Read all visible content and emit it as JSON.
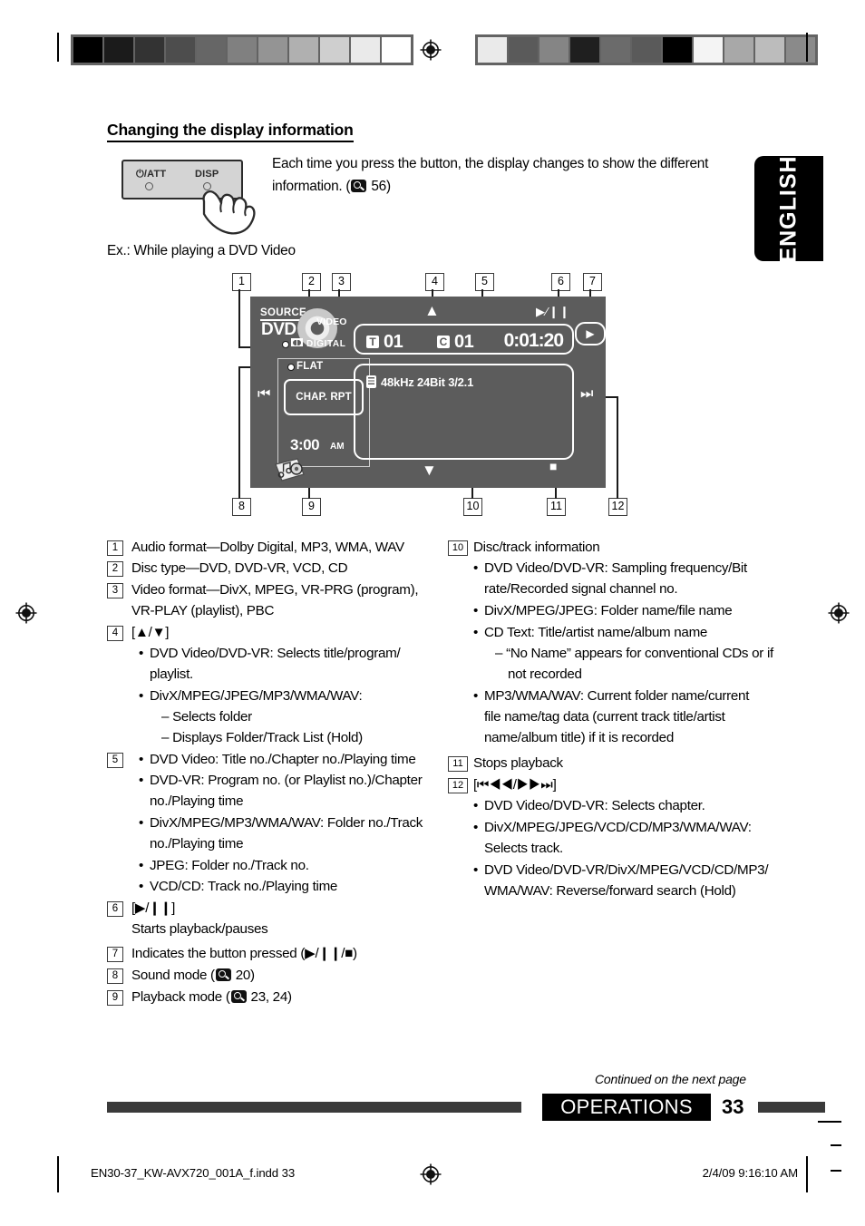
{
  "page": {
    "language_tab": "ENGLISH",
    "section_heading": "Changing the display information",
    "intro_line1": "Each time you press the button, the display changes to show the different",
    "intro_line2_pre": "information. (",
    "intro_page_ref": "56",
    "intro_line2_post": ")",
    "example_label": "Ex.:  While playing a DVD Video"
  },
  "disp_button": {
    "power_label": "⏻/ATT",
    "disp_label": "DISP"
  },
  "callouts": {
    "top": [
      "1",
      "2",
      "3",
      "4",
      "5",
      "6",
      "7"
    ],
    "bottom": [
      "8",
      "9",
      "10",
      "11",
      "12"
    ]
  },
  "lcd": {
    "source_word": "SOURCE",
    "source_value": "DVD",
    "audio_format": "DIGITAL",
    "disc_label": "VIDEO",
    "eq_mode": "FLAT",
    "playback_mode": "CHAP. RPT",
    "clock_time": "3:00",
    "clock_ampm": "AM",
    "title_tag": "T",
    "title_no": "01",
    "chapter_tag": "C",
    "chapter_no": "01",
    "playing_time": "0:01:20",
    "detail_info": "48kHz  24Bit  3/2.1",
    "up_arrow": "▲",
    "down_arrow": "▼",
    "play_pause": "▶∕❙❙",
    "stop": "■",
    "prev_track": "⏮",
    "next_track": "⏭",
    "pressed_indicator": "▶"
  },
  "legend_left": [
    {
      "num": "1",
      "lines": [
        "Audio format—Dolby Digital, MP3, WMA, WAV"
      ]
    },
    {
      "num": "2",
      "lines": [
        "Disc type—DVD, DVD-VR, VCD, CD"
      ]
    },
    {
      "num": "3",
      "lines": [
        "Video format—DivX, MPEG, VR-PRG (program),",
        "VR-PLAY (playlist), PBC"
      ]
    },
    {
      "num": "4",
      "lines": [
        "[▲/▼]"
      ],
      "bullets": [
        [
          "DVD Video/DVD-VR: Selects title/program/",
          "playlist."
        ],
        [
          "DivX/MPEG/JPEG/MP3/WMA/WAV:"
        ]
      ],
      "dashes": [
        "– Selects folder",
        "– Displays Folder/Track List (Hold)"
      ]
    },
    {
      "num": "5",
      "bullets": [
        [
          "DVD Video: Title no./Chapter no./Playing time"
        ],
        [
          "DVD-VR: Program no. (or Playlist no.)/Chapter",
          "no./Playing time"
        ],
        [
          "DivX/MPEG/MP3/WMA/WAV: Folder no./Track",
          "no./Playing time"
        ],
        [
          "JPEG: Folder no./Track no."
        ],
        [
          "VCD/CD: Track no./Playing time"
        ]
      ]
    },
    {
      "num": "6",
      "lines": [
        "[▶/❙❙]",
        "Starts playback/pauses"
      ]
    },
    {
      "num": "7",
      "lines": [
        "Indicates the button pressed (▶/❙❙/■)"
      ]
    },
    {
      "num": "8",
      "lines": [
        "Sound mode ("
      ],
      "page_ref": "20",
      "suffix": ")"
    },
    {
      "num": "9",
      "lines": [
        "Playback mode ("
      ],
      "page_ref": "23, 24",
      "suffix": ")"
    }
  ],
  "legend_right": [
    {
      "num": "10",
      "lines": [
        "Disc/track information"
      ],
      "bullets": [
        [
          "DVD Video/DVD-VR: Sampling frequency/Bit",
          "rate/Recorded signal channel no."
        ],
        [
          "DivX/MPEG/JPEG: Folder name/file name"
        ],
        [
          "CD Text: Title/artist name/album name"
        ],
        [
          "MP3/WMA/WAV: Current folder name/current",
          "file name/tag data (current track title/artist",
          "name/album title) if it is recorded"
        ]
      ],
      "dashes": [
        "– “No Name” appears for conventional CDs or if",
        "not recorded"
      ]
    },
    {
      "num": "11",
      "lines": [
        "Stops playback"
      ]
    },
    {
      "num": "12",
      "lines": [
        "[⏮◀◀/▶▶⏭]"
      ],
      "bullets": [
        [
          "DVD Video/DVD-VR: Selects chapter."
        ],
        [
          "DivX/MPEG/JPEG/VCD/CD/MP3/WMA/WAV:",
          "Selects track."
        ],
        [
          "DVD Video/DVD-VR/DivX/MPEG/VCD/CD/MP3/",
          "WMA/WAV: Reverse/forward search (Hold)"
        ]
      ]
    }
  ],
  "footer": {
    "continued": "Continued on the next page",
    "section_name": "OPERATIONS",
    "page_number": "33",
    "imprint_left": "EN30-37_KW-AVX720_001A_f.indd   33",
    "imprint_right": "2/4/09   9:16:10 AM"
  },
  "calibration": {
    "left_bar": [
      "#000000",
      "#1b1b1b",
      "#333333",
      "#4d4d4d",
      "#666666",
      "#808080",
      "#949494",
      "#b0b0b0",
      "#cfcfcf",
      "#eaeaea",
      "#ffffff"
    ],
    "right_bar": [
      "#eaeaea",
      "#5a5a5a",
      "#858585",
      "#1f1f1f",
      "#6b6b6b",
      "#5a5a5a",
      "#000000",
      "#f4f4f4",
      "#a8a8a8",
      "#bcbcbc",
      "#8a8a8a"
    ]
  }
}
